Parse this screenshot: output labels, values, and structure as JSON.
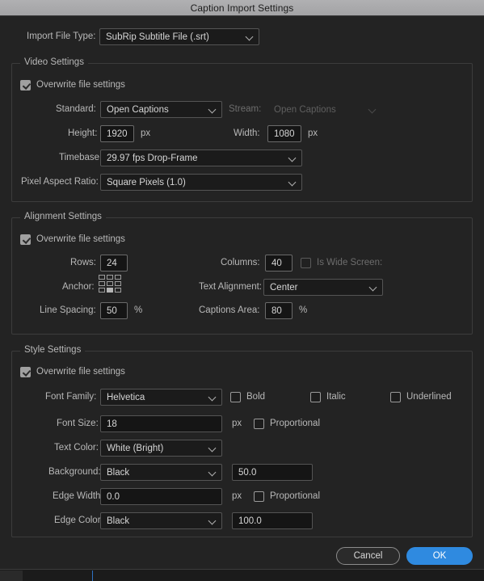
{
  "window": {
    "title": "Caption Import Settings"
  },
  "top": {
    "import_file_type_label": "Import File Type:",
    "import_file_type_value": "SubRip Subtitle File (.srt)"
  },
  "video_settings": {
    "group_title": "Video Settings",
    "overwrite_label": "Overwrite file settings",
    "overwrite_checked": true,
    "standard_label": "Standard:",
    "standard_value": "Open Captions",
    "stream_label": "Stream:",
    "stream_value": "Open Captions",
    "stream_disabled": true,
    "height_label": "Height:",
    "height_value": "1920",
    "height_unit": "px",
    "width_label": "Width:",
    "width_value": "1080",
    "width_unit": "px",
    "timebase_label": "Timebase:",
    "timebase_value": "29.97 fps Drop-Frame",
    "pixel_aspect_label": "Pixel Aspect Ratio:",
    "pixel_aspect_value": "Square Pixels (1.0)"
  },
  "alignment_settings": {
    "group_title": "Alignment Settings",
    "overwrite_label": "Overwrite file settings",
    "overwrite_checked": true,
    "rows_label": "Rows:",
    "rows_value": "24",
    "columns_label": "Columns:",
    "columns_value": "40",
    "wide_screen_label": "Is Wide Screen:",
    "wide_screen_checked": false,
    "anchor_label": "Anchor:",
    "anchor_selected": "bottom-center",
    "text_alignment_label": "Text Alignment:",
    "text_alignment_value": "Center",
    "line_spacing_label": "Line Spacing:",
    "line_spacing_value": "50",
    "line_spacing_unit": "%",
    "captions_area_label": "Captions Area:",
    "captions_area_value": "80",
    "captions_area_unit": "%"
  },
  "style_settings": {
    "group_title": "Style Settings",
    "overwrite_label": "Overwrite file settings",
    "overwrite_checked": true,
    "font_family_label": "Font Family:",
    "font_family_value": "Helvetica",
    "bold_label": "Bold",
    "bold_checked": false,
    "italic_label": "Italic",
    "italic_checked": false,
    "underlined_label": "Underlined",
    "underlined_checked": false,
    "font_size_label": "Font Size:",
    "font_size_value": "18",
    "font_size_unit": "px",
    "font_proportional_label": "Proportional",
    "font_proportional_checked": false,
    "text_color_label": "Text Color:",
    "text_color_value": "White (Bright)",
    "background_label": "Background:",
    "background_value": "Black",
    "background_opacity": "50.0",
    "edge_width_label": "Edge Width:",
    "edge_width_value": "0.0",
    "edge_width_unit": "px",
    "edge_proportional_label": "Proportional",
    "edge_proportional_checked": false,
    "edge_color_label": "Edge Color:",
    "edge_color_value": "Black",
    "edge_color_opacity": "100.0"
  },
  "footer": {
    "cancel_label": "Cancel",
    "ok_label": "OK"
  },
  "colors": {
    "accent": "#2f8ae0",
    "dialog_bg": "#232323",
    "titlebar": "#a8a8aa",
    "field_bg": "#151515",
    "border": "#3c3c3c"
  }
}
